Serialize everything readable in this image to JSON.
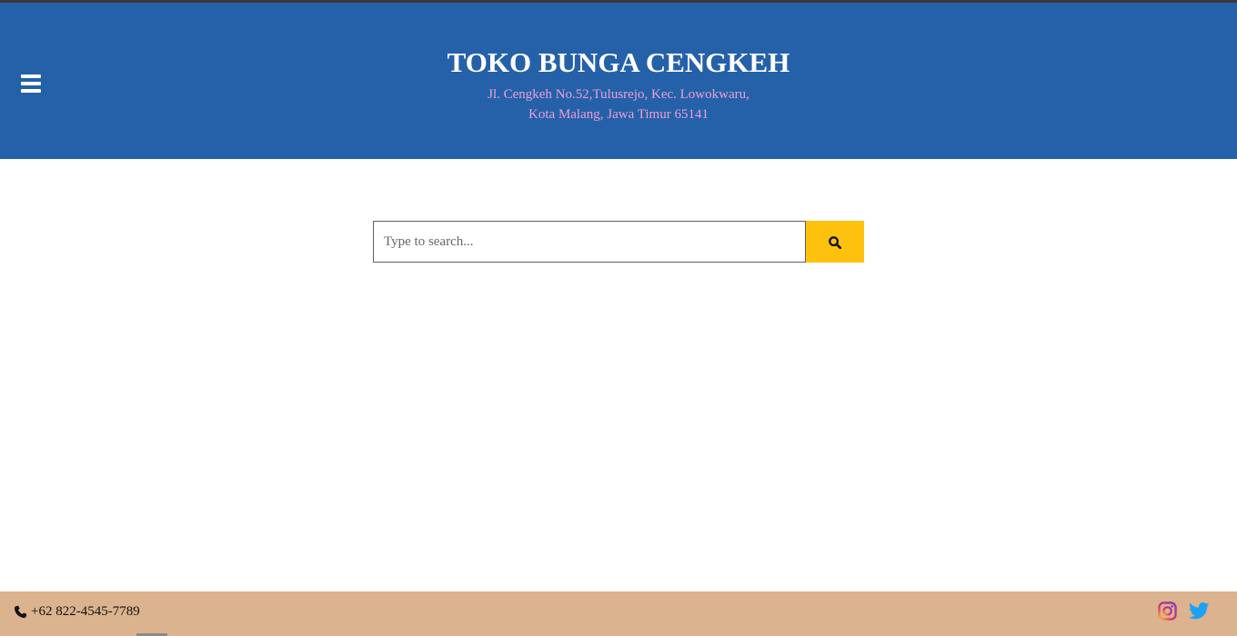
{
  "header": {
    "title": "TOKO BUNGA CENGKEH",
    "address_line1": "Jl. Cengkeh No.52,Tulusrejo, Kec. Lowokwaru,",
    "address_line2": "Kota Malang, Jawa Timur 65141",
    "menu_icon": "hamburger-menu-icon"
  },
  "search": {
    "placeholder": "Type to search...",
    "value": "",
    "button_icon": "search-icon"
  },
  "footer": {
    "phone": "+62 822-4545-7789",
    "phone_icon": "phone-icon",
    "social": [
      "instagram-icon",
      "twitter-icon"
    ]
  },
  "colors": {
    "header_bg": "#2461a9",
    "address_text": "#ef9fd6",
    "search_button": "#fec10e",
    "footer_bg": "#dbb38f",
    "instagram": "#c13584",
    "twitter": "#1da1f2"
  }
}
